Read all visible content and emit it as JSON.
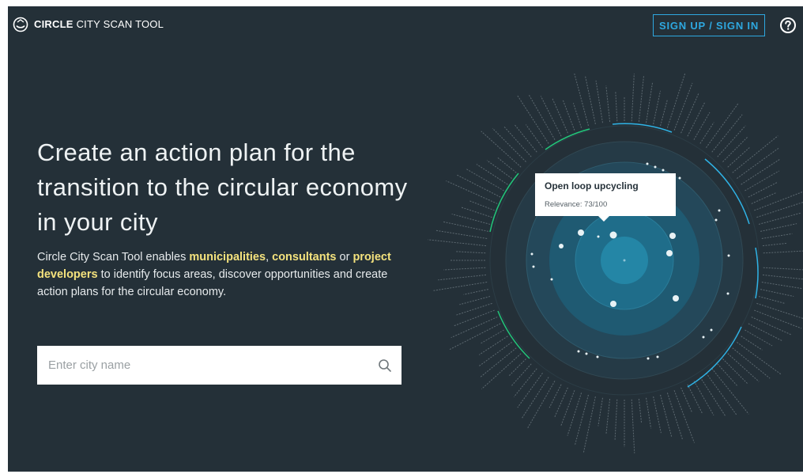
{
  "header": {
    "brand_bold": "CIRCLE",
    "brand_light": "CITY SCAN TOOL",
    "signup_label": "SIGN UP / SIGN IN"
  },
  "hero": {
    "headline": "Create an action plan for the transition to the circular economy in your city",
    "intro_1": "Circle City Scan Tool enables ",
    "intro_municipalities": "municipalities",
    "intro_comma": ", ",
    "intro_consultants": "consultants",
    "intro_or": " or ",
    "intro_project_developers": "project developers",
    "intro_2": " to identify focus areas, discover opportunities and create action plans for the circular economy."
  },
  "search": {
    "placeholder": "Enter city name"
  },
  "tooltip": {
    "title": "Open loop upcycling",
    "relevance": "Relevance: 73/100"
  },
  "colors": {
    "background": "#243038",
    "accent_blue": "#2ea8e0",
    "highlight_yellow": "#f4e27d",
    "category_green": "#22c77a",
    "category_blue": "#2fb3e6"
  }
}
